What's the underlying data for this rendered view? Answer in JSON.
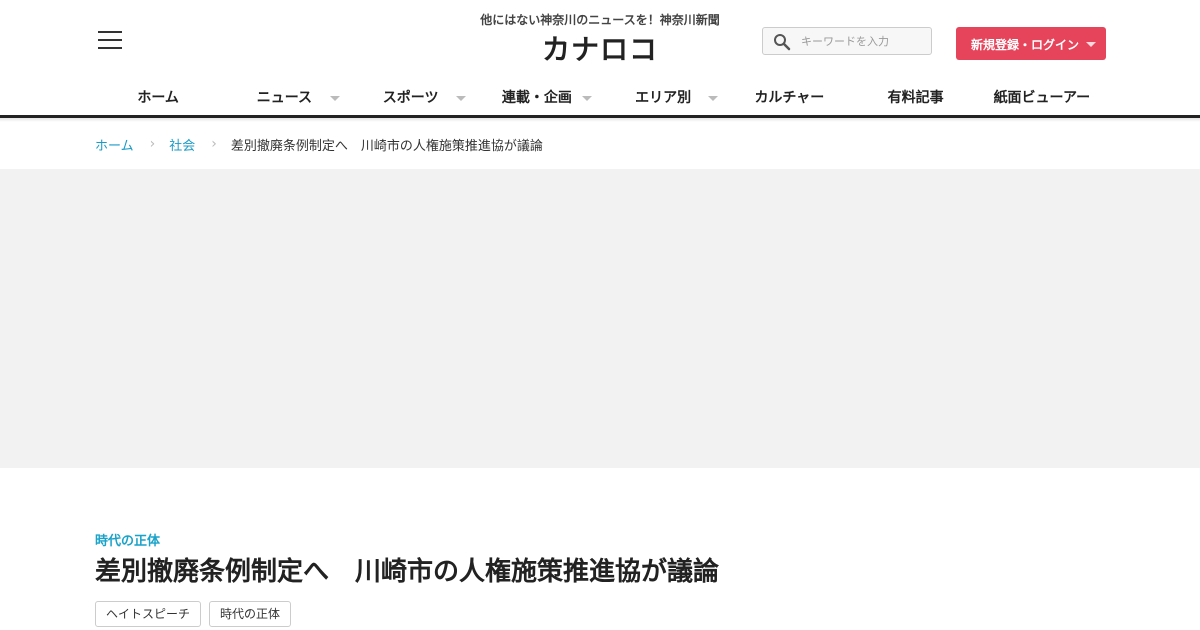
{
  "header": {
    "tagline": "他にはない神奈川のニュースを！神奈川新聞",
    "logo": "カナロコ",
    "search": {
      "placeholder": "キーワードを入力",
      "value": ""
    },
    "login_label": "新規登録・ログイン"
  },
  "nav": [
    {
      "label": "ホーム",
      "has_dropdown": false
    },
    {
      "label": "ニュース",
      "has_dropdown": true
    },
    {
      "label": "スポーツ",
      "has_dropdown": true
    },
    {
      "label": "連載・企画",
      "has_dropdown": true
    },
    {
      "label": "エリア別",
      "has_dropdown": true
    },
    {
      "label": "カルチャー",
      "has_dropdown": false
    },
    {
      "label": "有料記事",
      "has_dropdown": false
    },
    {
      "label": "紙面ビューアー",
      "has_dropdown": false
    }
  ],
  "breadcrumb": {
    "home": "ホーム",
    "section": "社会",
    "current": "差別撤廃条例制定へ　川崎市の人権施策推進協が議論"
  },
  "article": {
    "category": "時代の正体",
    "title": "差別撤廃条例制定へ　川崎市の人権施策推進協が議論",
    "tags": [
      "ヘイトスピーチ",
      "時代の正体"
    ]
  },
  "colors": {
    "accent_link": "#1a9bc7",
    "category": "#1aa3c9",
    "login_button": "#e6445a",
    "ad_background": "#f2f2f2"
  },
  "icons": {
    "menu": "hamburger-icon",
    "search": "search-icon"
  }
}
